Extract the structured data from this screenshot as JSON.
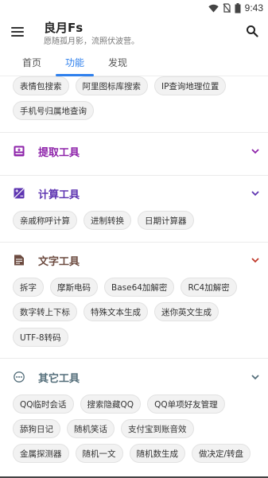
{
  "status": {
    "time": "9:43"
  },
  "app": {
    "title": "良月Fs",
    "subtitle": "愿随孤月影，流照伏波营。"
  },
  "tabs": [
    {
      "label": "首页"
    },
    {
      "label": "功能"
    },
    {
      "label": "发现"
    }
  ],
  "colors": {
    "accent": "#2f80ed",
    "purple": "#8e24aa",
    "deep_purple": "#5e35b1",
    "brown": "#6d4c41",
    "slate": "#546e7a"
  },
  "search_section_chips": [
    [
      "表情包搜索",
      "阿里图标库搜索",
      "IP查询地理位置"
    ],
    [
      "手机号归属地查询"
    ]
  ],
  "sections": {
    "extract": {
      "title": "提取工具",
      "icon": "download-box-icon",
      "color": "#8e24aa",
      "expanded": false
    },
    "calc": {
      "title": "计算工具",
      "icon": "calculator-icon",
      "color": "#5e35b1",
      "expanded": true,
      "chips": [
        [
          "亲戚称呼计算",
          "进制转换",
          "日期计算器"
        ]
      ]
    },
    "text": {
      "title": "文字工具",
      "icon": "document-icon",
      "color": "#6d4c41",
      "expanded": true,
      "chips": [
        [
          "拆字",
          "摩斯电码",
          "Base64加解密",
          "RC4加解密"
        ],
        [
          "数字转上下标",
          "特殊文本生成",
          "迷你英文生成"
        ],
        [
          "UTF-8转码"
        ]
      ]
    },
    "other": {
      "title": "其它工具",
      "icon": "more-dots-icon",
      "color": "#546e7a",
      "expanded": true,
      "chips": [
        [
          "QQ临时会话",
          "搜索隐藏QQ",
          "QQ单项好友管理"
        ],
        [
          "舔狗日记",
          "随机笑话",
          "支付宝到账音效"
        ],
        [
          "金属探测器",
          "随机一文",
          "随机数生成",
          "做决定/转盘"
        ]
      ]
    }
  }
}
